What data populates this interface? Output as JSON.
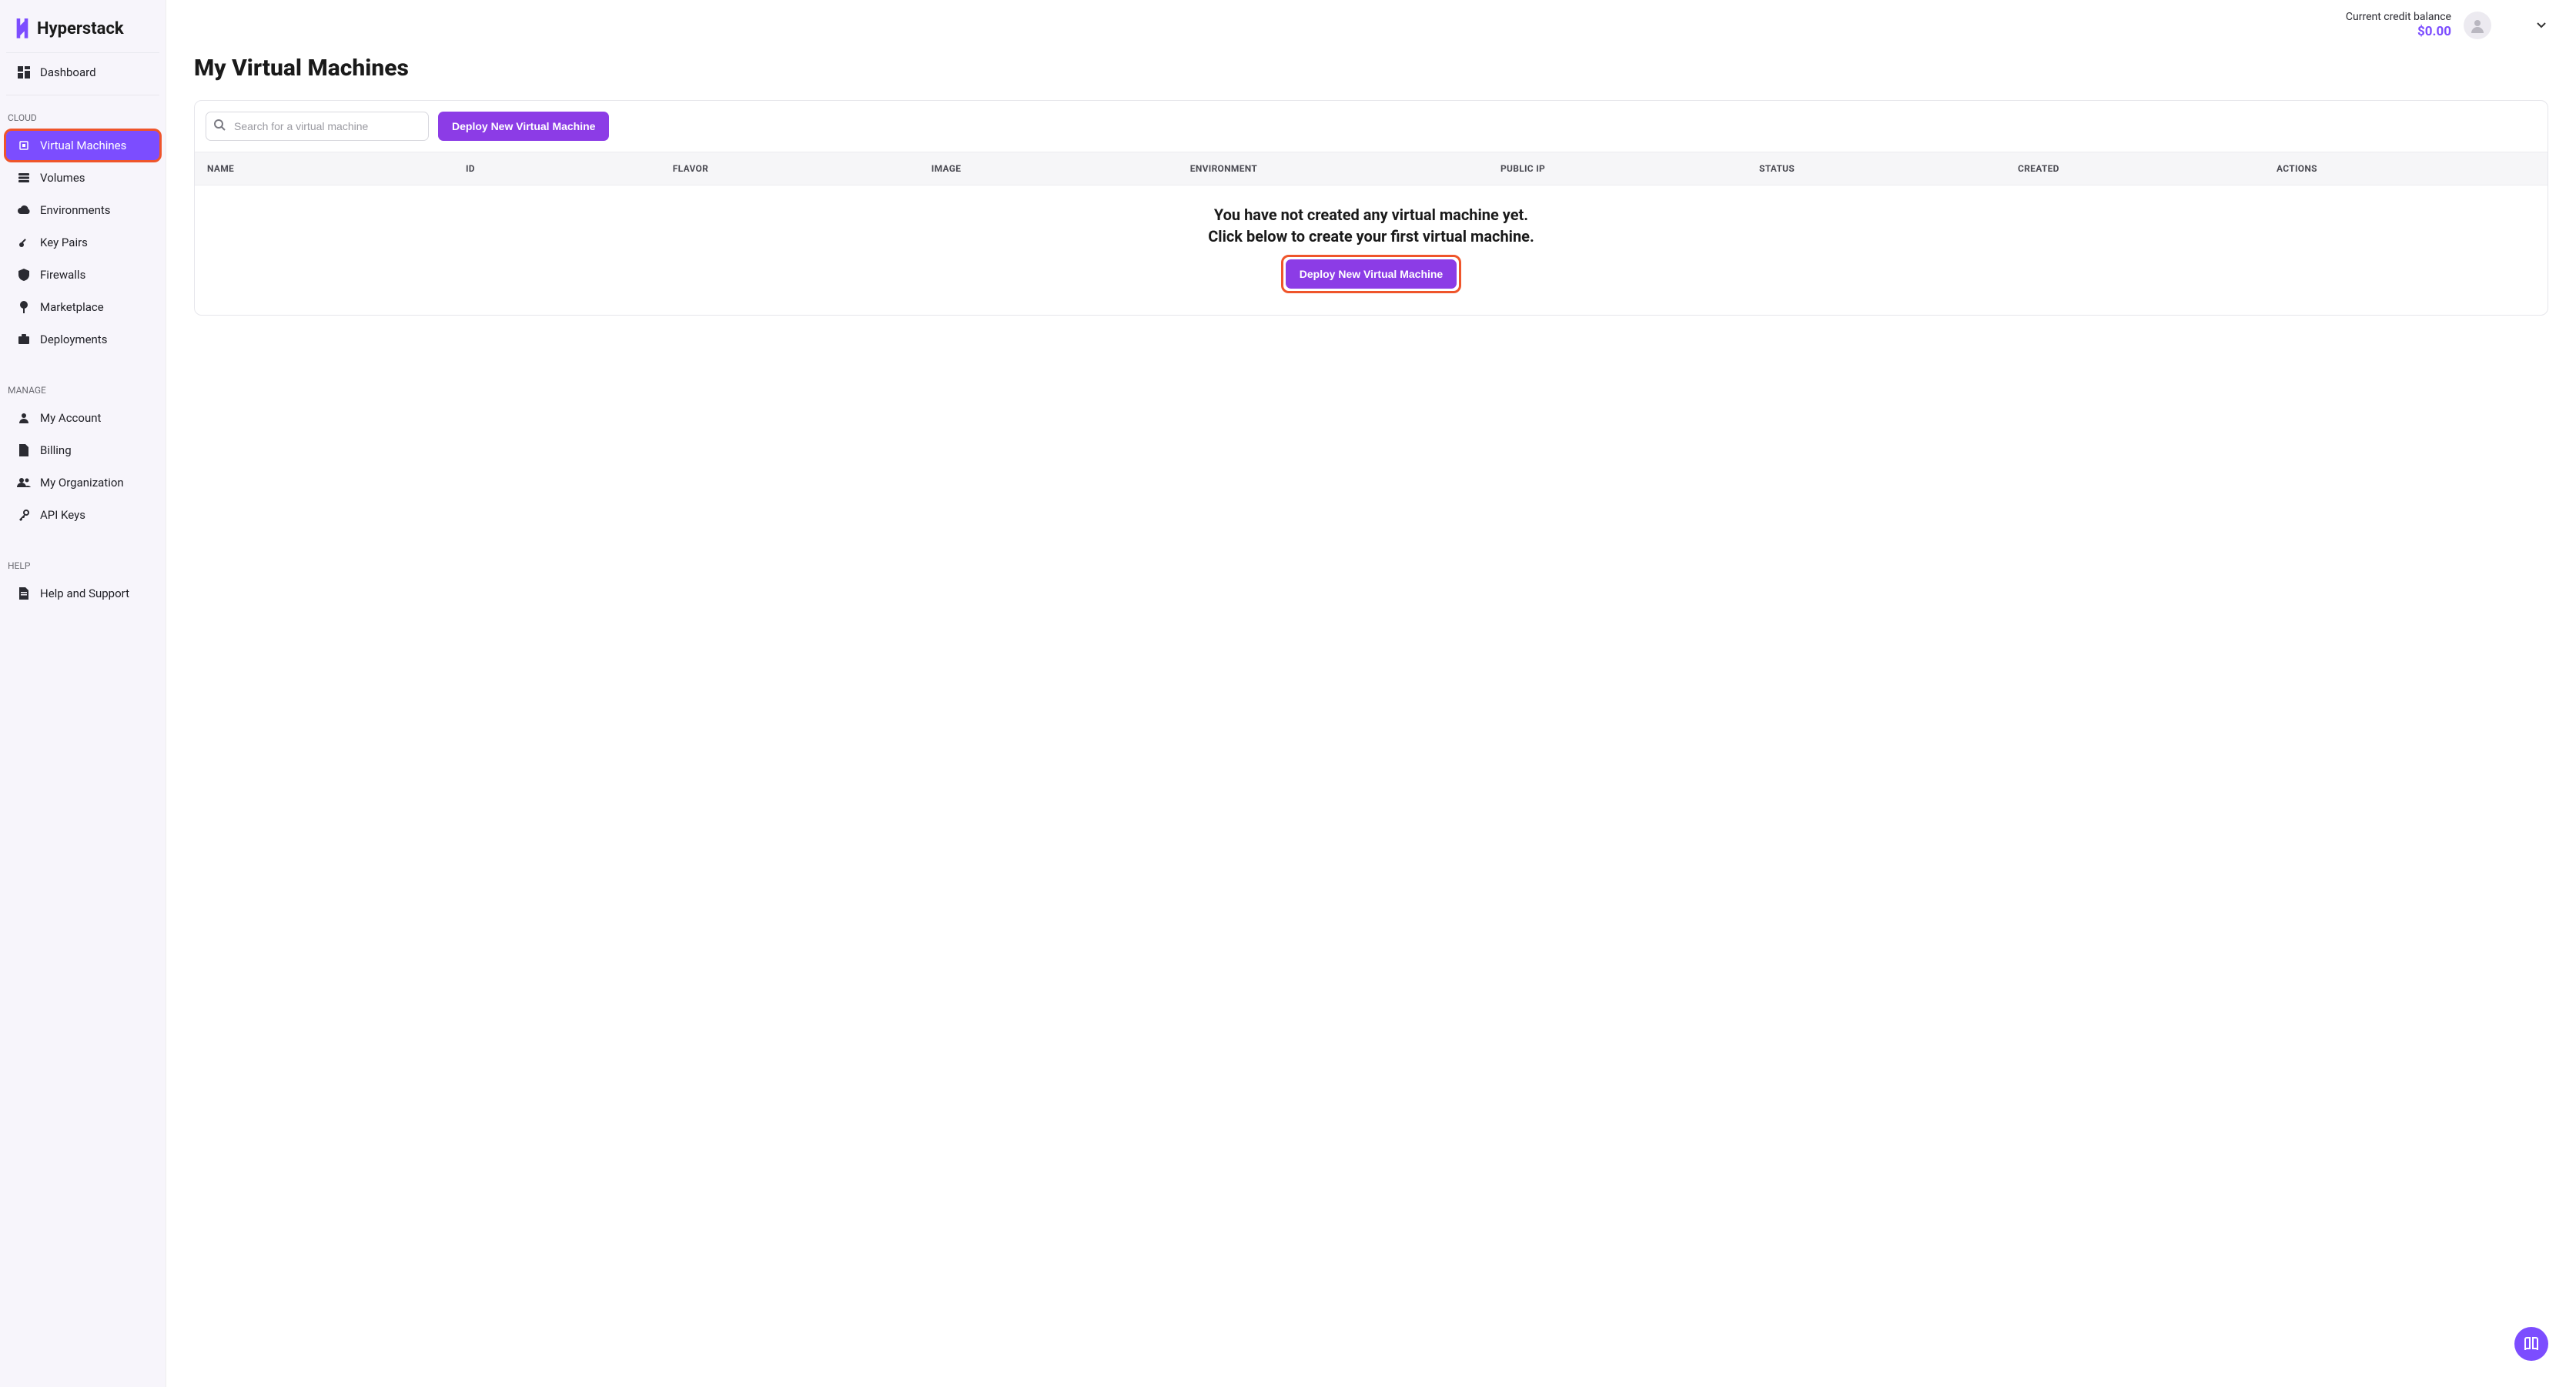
{
  "brand": {
    "name": "Hyperstack"
  },
  "sidebar": {
    "dashboard": "Dashboard",
    "section_cloud": "CLOUD",
    "cloud_items": [
      {
        "label": "Virtual Machines",
        "icon": "chip-icon",
        "active": true
      },
      {
        "label": "Volumes",
        "icon": "volume-icon"
      },
      {
        "label": "Environments",
        "icon": "cloud-icon"
      },
      {
        "label": "Key Pairs",
        "icon": "key-icon"
      },
      {
        "label": "Firewalls",
        "icon": "shield-icon"
      },
      {
        "label": "Marketplace",
        "icon": "pin-icon"
      },
      {
        "label": "Deployments",
        "icon": "briefcase-icon"
      }
    ],
    "section_manage": "MANAGE",
    "manage_items": [
      {
        "label": "My Account",
        "icon": "person-icon"
      },
      {
        "label": "Billing",
        "icon": "file-icon"
      },
      {
        "label": "My Organization",
        "icon": "people-icon"
      },
      {
        "label": "API Keys",
        "icon": "apikey-icon"
      }
    ],
    "section_help": "HELP",
    "help_items": [
      {
        "label": "Help and Support",
        "icon": "doc-icon"
      }
    ]
  },
  "topbar": {
    "balance_label": "Current credit balance",
    "balance_value": "$0.00"
  },
  "page": {
    "title": "My Virtual Machines",
    "search_placeholder": "Search for a virtual machine",
    "deploy_label": "Deploy New Virtual Machine",
    "table_headers": [
      "NAME",
      "ID",
      "FLAVOR",
      "IMAGE",
      "ENVIRONMENT",
      "PUBLIC IP",
      "STATUS",
      "CREATED",
      "ACTIONS"
    ],
    "empty_line1": "You have not created any virtual machine yet.",
    "empty_line2": "Click below to create your first virtual machine.",
    "empty_deploy_label": "Deploy New Virtual Machine"
  }
}
